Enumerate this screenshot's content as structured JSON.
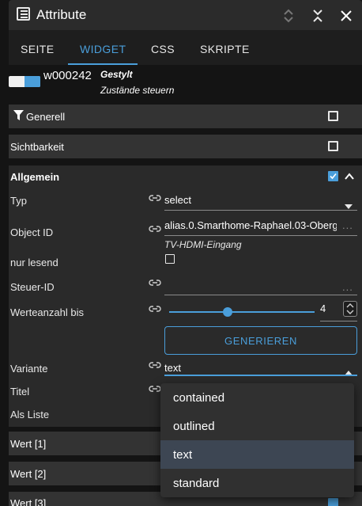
{
  "window": {
    "title": "Attribute"
  },
  "tabs": [
    "SEITE",
    "WIDGET",
    "CSS",
    "SKRIPTE"
  ],
  "widget": {
    "id": "w000242",
    "name": "Gestylt",
    "description": "Zustände steuern"
  },
  "sections": {
    "generell": "Generell",
    "sichtbarkeit": "Sichtbarkeit",
    "allgemein": "Allgemein",
    "wert1": "Wert [1]",
    "wert2": "Wert [2]",
    "wert3": "Wert [3]"
  },
  "fields": {
    "typ": {
      "label": "Typ",
      "value": "select"
    },
    "object_id": {
      "label": "Object ID",
      "value": "alias.0.Smarthome-Raphael.03-Oberg",
      "subtitle": "TV-HDMI-Eingang",
      "more": "..."
    },
    "nur_lesend": {
      "label": "nur lesend"
    },
    "steuer_id": {
      "label": "Steuer-ID",
      "more": "..."
    },
    "werteanzahl": {
      "label": "Werteanzahl bis",
      "value": "4",
      "slider_fraction": 0.37
    },
    "generate_button": "GENERIEREN",
    "variante": {
      "label": "Variante",
      "value": "text"
    },
    "titel": {
      "label": "Titel"
    },
    "als_liste": {
      "label": "Als Liste"
    }
  },
  "dropdown": {
    "options": [
      "contained",
      "outlined",
      "text",
      "standard"
    ],
    "selected": "text"
  },
  "colors": {
    "accent": "#4a9eda",
    "section_bg": "#333333",
    "panel_bg": "#2a2a2a"
  }
}
